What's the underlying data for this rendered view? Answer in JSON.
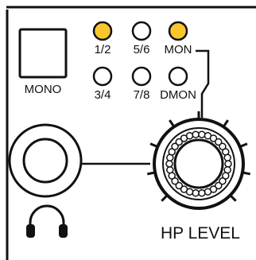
{
  "buttons": {
    "mono": {
      "label": "MONO"
    }
  },
  "indicators": [
    {
      "label": "1/2",
      "lit": true
    },
    {
      "label": "5/6",
      "lit": false
    },
    {
      "label": "MON",
      "lit": true
    },
    {
      "label": "3/4",
      "lit": false
    },
    {
      "label": "7/8",
      "lit": false
    },
    {
      "label": "DMON",
      "lit": false
    }
  ],
  "knob": {
    "label": "HP LEVEL"
  },
  "jack": {
    "icon": "headphones-icon"
  },
  "colors": {
    "lit": "#f8c72c",
    "unlit": "#ffffff",
    "stroke": "#111111"
  }
}
